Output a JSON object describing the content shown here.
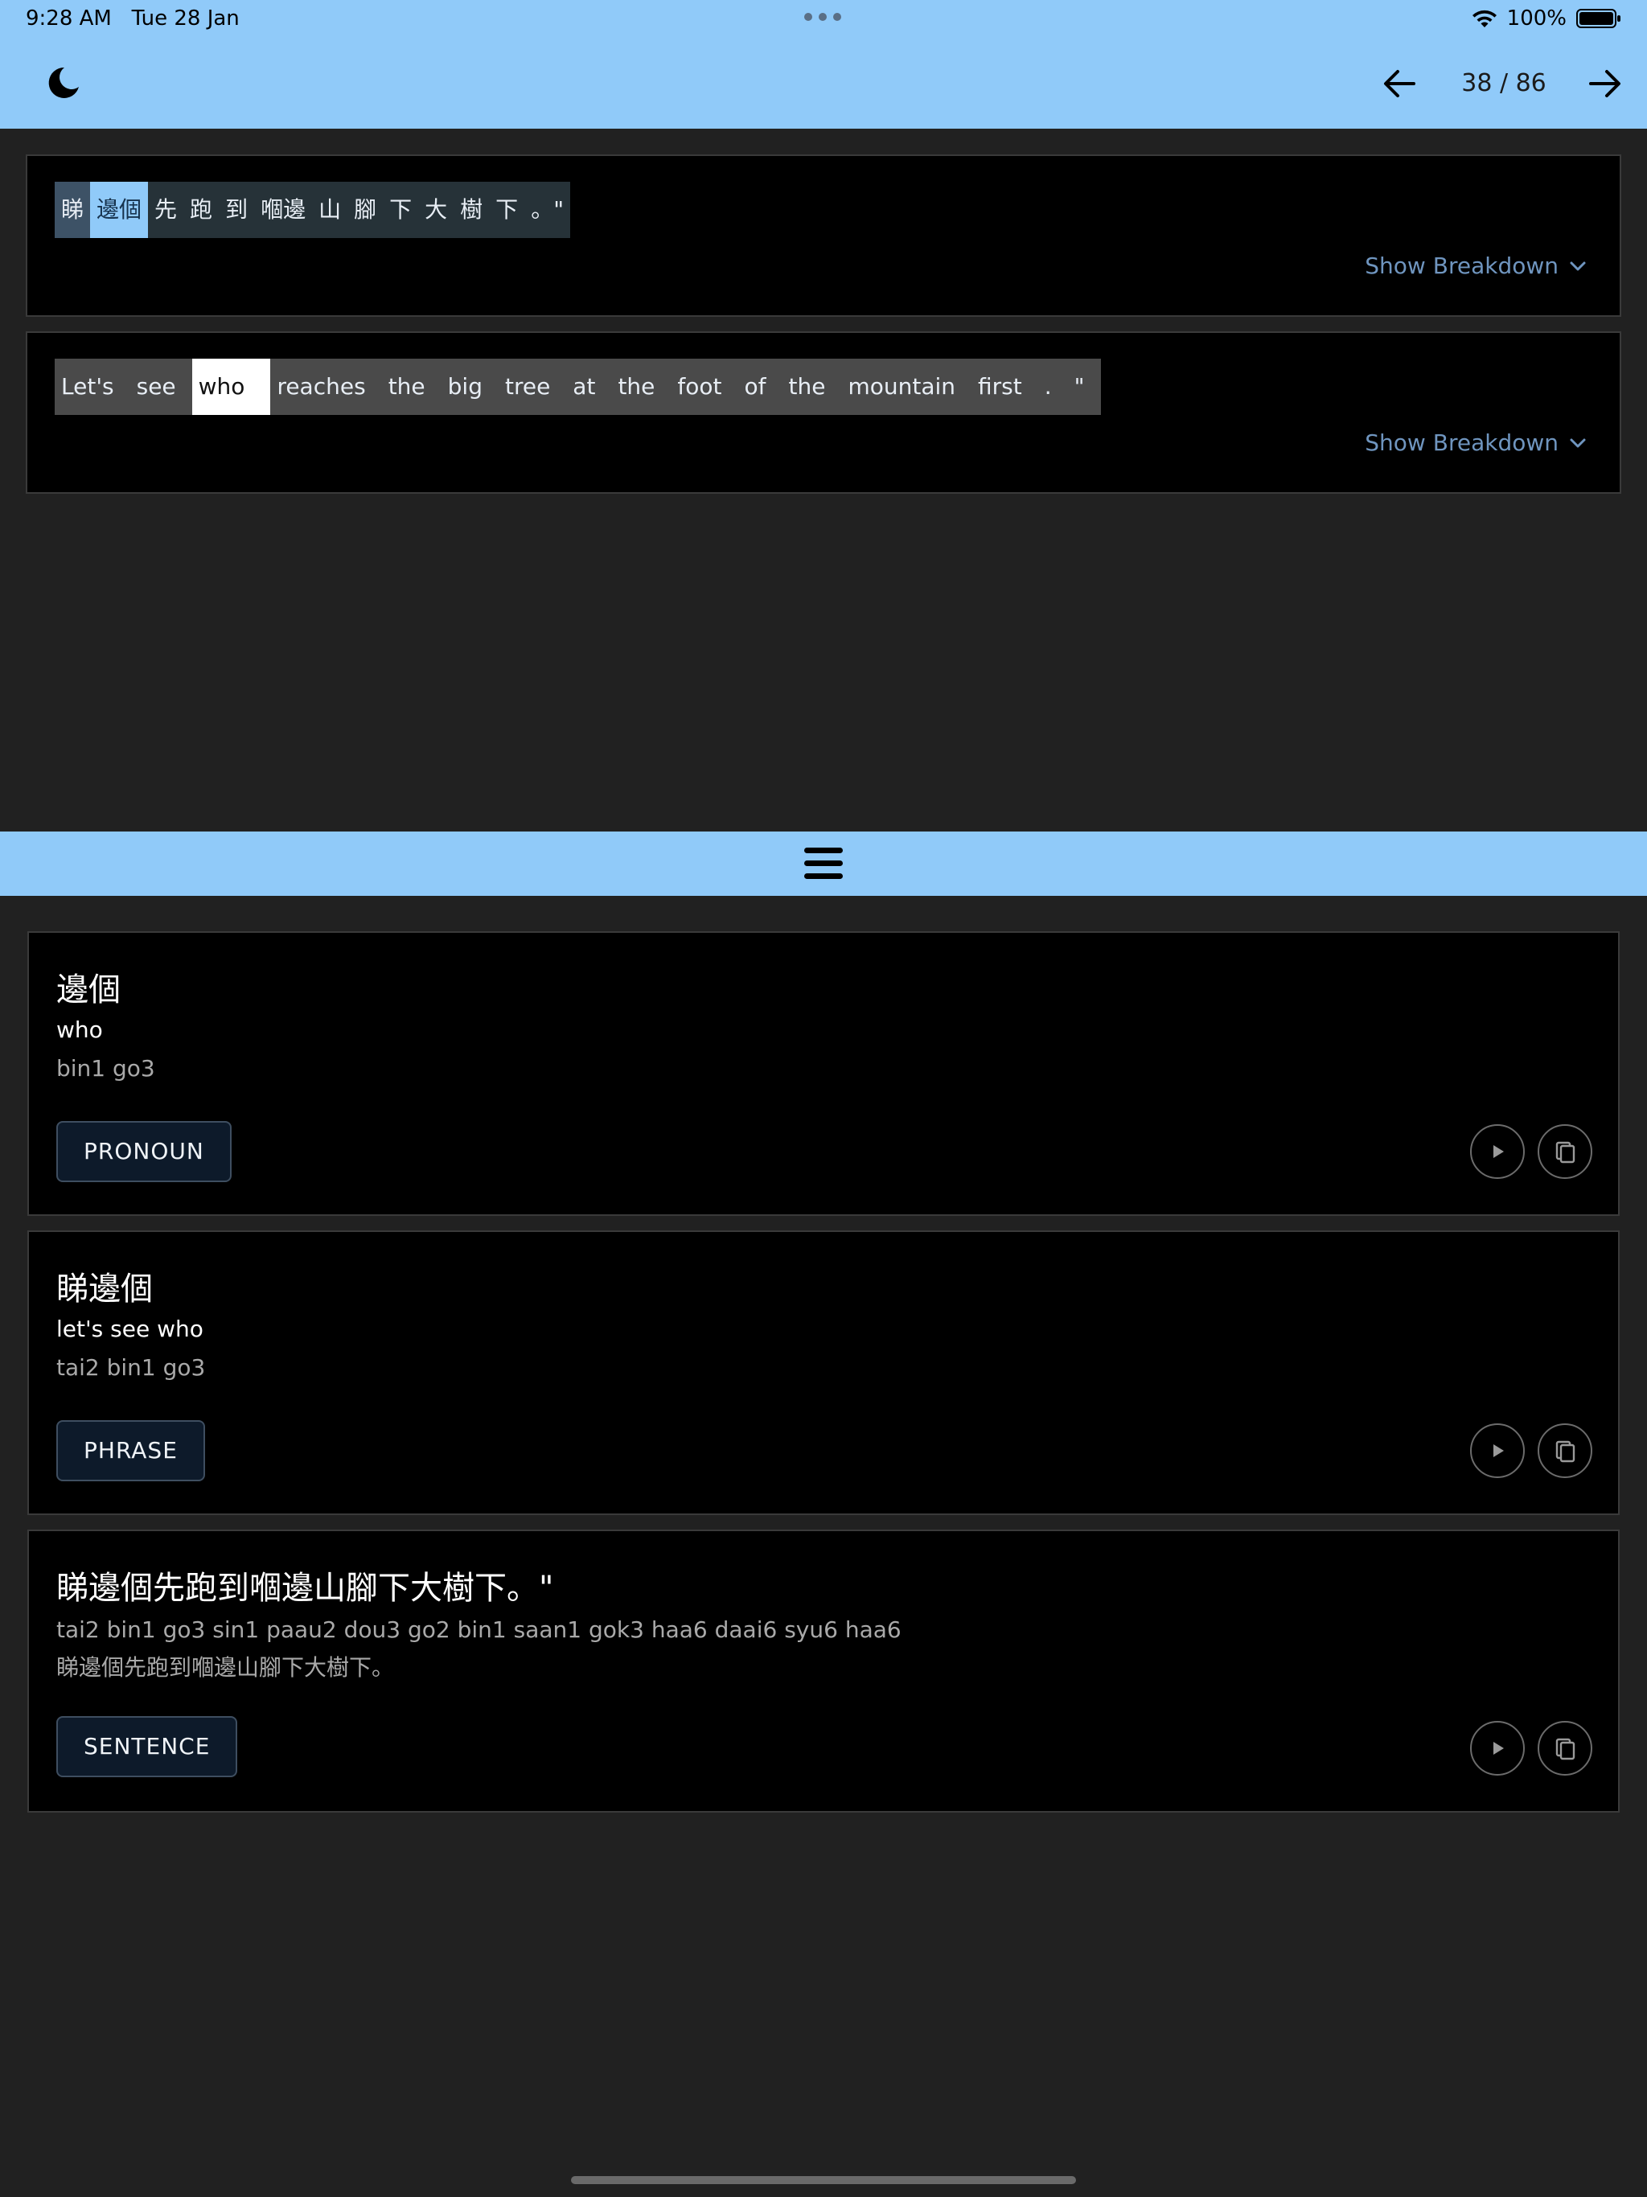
{
  "status_bar": {
    "time": "9:28 AM",
    "date": "Tue 28 Jan",
    "battery": "100%"
  },
  "header": {
    "page_current": "38",
    "page_total": "86",
    "page_indicator": "38 / 86"
  },
  "sentences": {
    "chinese": {
      "tokens": [
        "睇",
        "邊個",
        "先",
        "跑",
        "到",
        "嗰邊",
        "山",
        "腳",
        "下",
        "大",
        "樹",
        "下",
        "。\""
      ],
      "highlighted_index": 1,
      "breakdown_label": "Show Breakdown"
    },
    "english": {
      "tokens": [
        "Let's",
        "see",
        "who",
        "reaches",
        "the",
        "big",
        "tree",
        "at",
        "the",
        "foot",
        "of",
        "the",
        "mountain",
        "first",
        ".",
        "\""
      ],
      "highlighted_index": 2,
      "breakdown_label": "Show Breakdown"
    }
  },
  "entries": [
    {
      "title": "邊個",
      "line1": "who",
      "line2": "bin1 go3",
      "tag": "PRONOUN"
    },
    {
      "title": "睇邊個",
      "line1": "let's see who",
      "line2": "tai2 bin1 go3",
      "tag": "PHRASE"
    },
    {
      "title": "睇邊個先跑到嗰邊山腳下大樹下。\"",
      "line2": "tai2 bin1 go3 sin1 paau2 dou3 go2 bin1 saan1 gok3 haa6 daai6 syu6 haa6",
      "line3": "睇邊個先跑到嗰邊山腳下大樹下。",
      "tag": "SENTENCE"
    }
  ],
  "colors": {
    "accent": "#90caf9",
    "background": "#212121",
    "card": "#000000",
    "link": "#6f95bf"
  }
}
